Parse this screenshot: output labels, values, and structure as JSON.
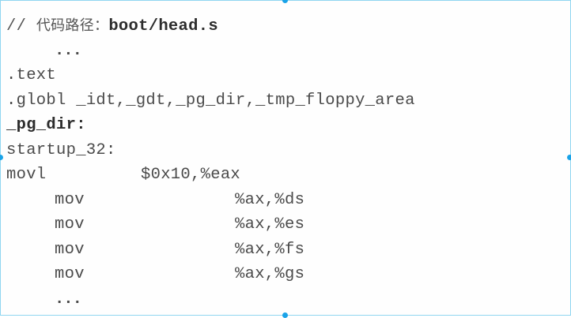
{
  "comment": {
    "prefix": "// ",
    "label": "代码路径：",
    "path": "boot/head.s"
  },
  "lines": {
    "ellipsis_top": "...",
    "text_directive": ".text",
    "globl_directive": ".globl _idt,_gdt,_pg_dir,_tmp_floppy_area",
    "pg_dir_label": "_pg_dir:",
    "startup_label": "startup_32:",
    "movl": {
      "op": "movl",
      "args": "$0x10,%eax"
    },
    "mov_ds": {
      "op": "mov",
      "args": "%ax,%ds"
    },
    "mov_es": {
      "op": "mov",
      "args": "%ax,%es"
    },
    "mov_fs": {
      "op": "mov",
      "args": "%ax,%fs"
    },
    "mov_gs": {
      "op": "mov",
      "args": "%ax,%gs"
    },
    "ellipsis_bottom": "..."
  },
  "colors": {
    "frame_border": "#8fd6f0",
    "handle": "#1aa3e8",
    "text": "#4a4a4a"
  }
}
